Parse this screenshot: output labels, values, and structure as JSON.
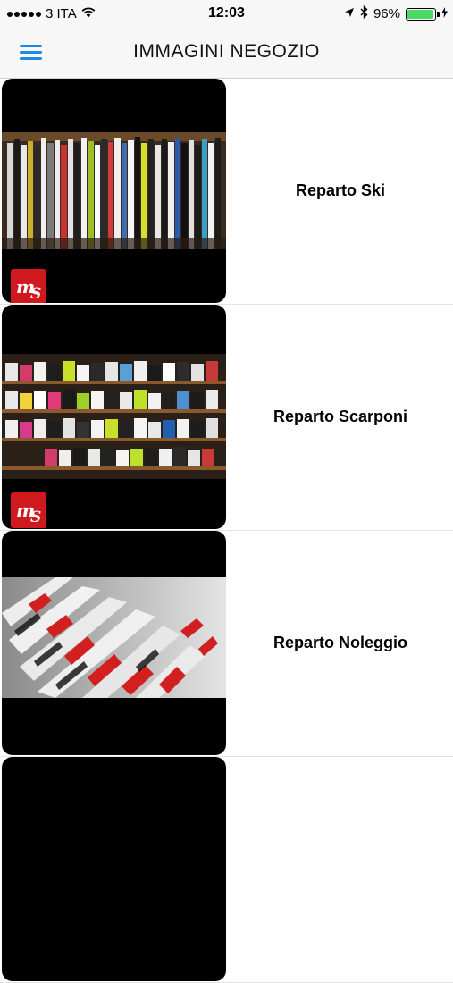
{
  "status_bar": {
    "carrier": "3 ITA",
    "time": "12:03",
    "battery_percent": "96%",
    "battery_level": 0.96
  },
  "nav": {
    "title": "IMMAGINI NEGOZIO",
    "menu_icon": "hamburger-menu-icon",
    "accent_color": "#1e88e5"
  },
  "list": {
    "items": [
      {
        "label": "Reparto Ski",
        "image": "ski-rack-photo"
      },
      {
        "label": "Reparto Scarponi",
        "image": "boot-shelves-photo"
      },
      {
        "label": "Reparto Noleggio",
        "image": "rental-skis-photo"
      },
      {
        "label": "",
        "image": "partial-photo"
      }
    ]
  },
  "logo_text": "mS"
}
